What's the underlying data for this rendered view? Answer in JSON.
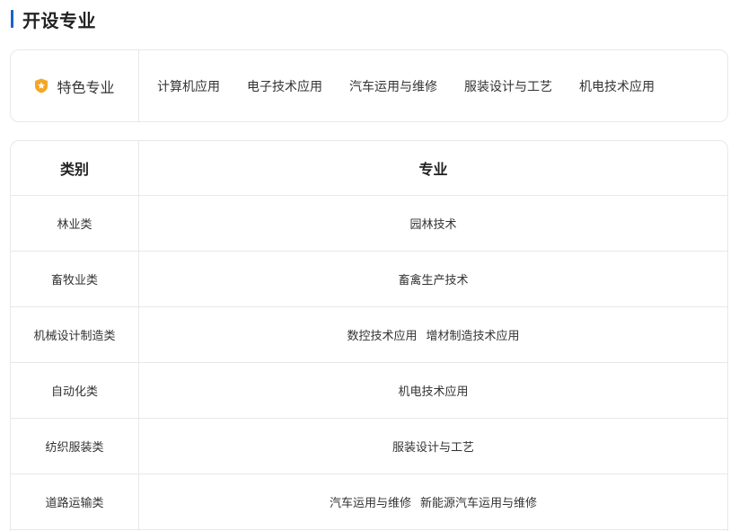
{
  "section": {
    "title": "开设专业"
  },
  "featured": {
    "label": "特色专业",
    "badge_icon": "star-shield-icon",
    "badge_color": "#f5a623",
    "items": [
      "计算机应用",
      "电子技术应用",
      "汽车运用与维修",
      "服装设计与工艺",
      "机电技术应用"
    ]
  },
  "table": {
    "headers": {
      "category": "类别",
      "major": "专业"
    },
    "rows": [
      {
        "category": "林业类",
        "majors": [
          "园林技术"
        ]
      },
      {
        "category": "畜牧业类",
        "majors": [
          "畜禽生产技术"
        ]
      },
      {
        "category": "机械设计制造类",
        "majors": [
          "数控技术应用",
          "增材制造技术应用"
        ]
      },
      {
        "category": "自动化类",
        "majors": [
          "机电技术应用"
        ]
      },
      {
        "category": "纺织服装类",
        "majors": [
          "服装设计与工艺"
        ]
      },
      {
        "category": "道路运输类",
        "majors": [
          "汽车运用与维修",
          "新能源汽车运用与维修"
        ]
      }
    ]
  },
  "colors": {
    "accent": "#1a63c6",
    "border": "#e8e8e8"
  }
}
